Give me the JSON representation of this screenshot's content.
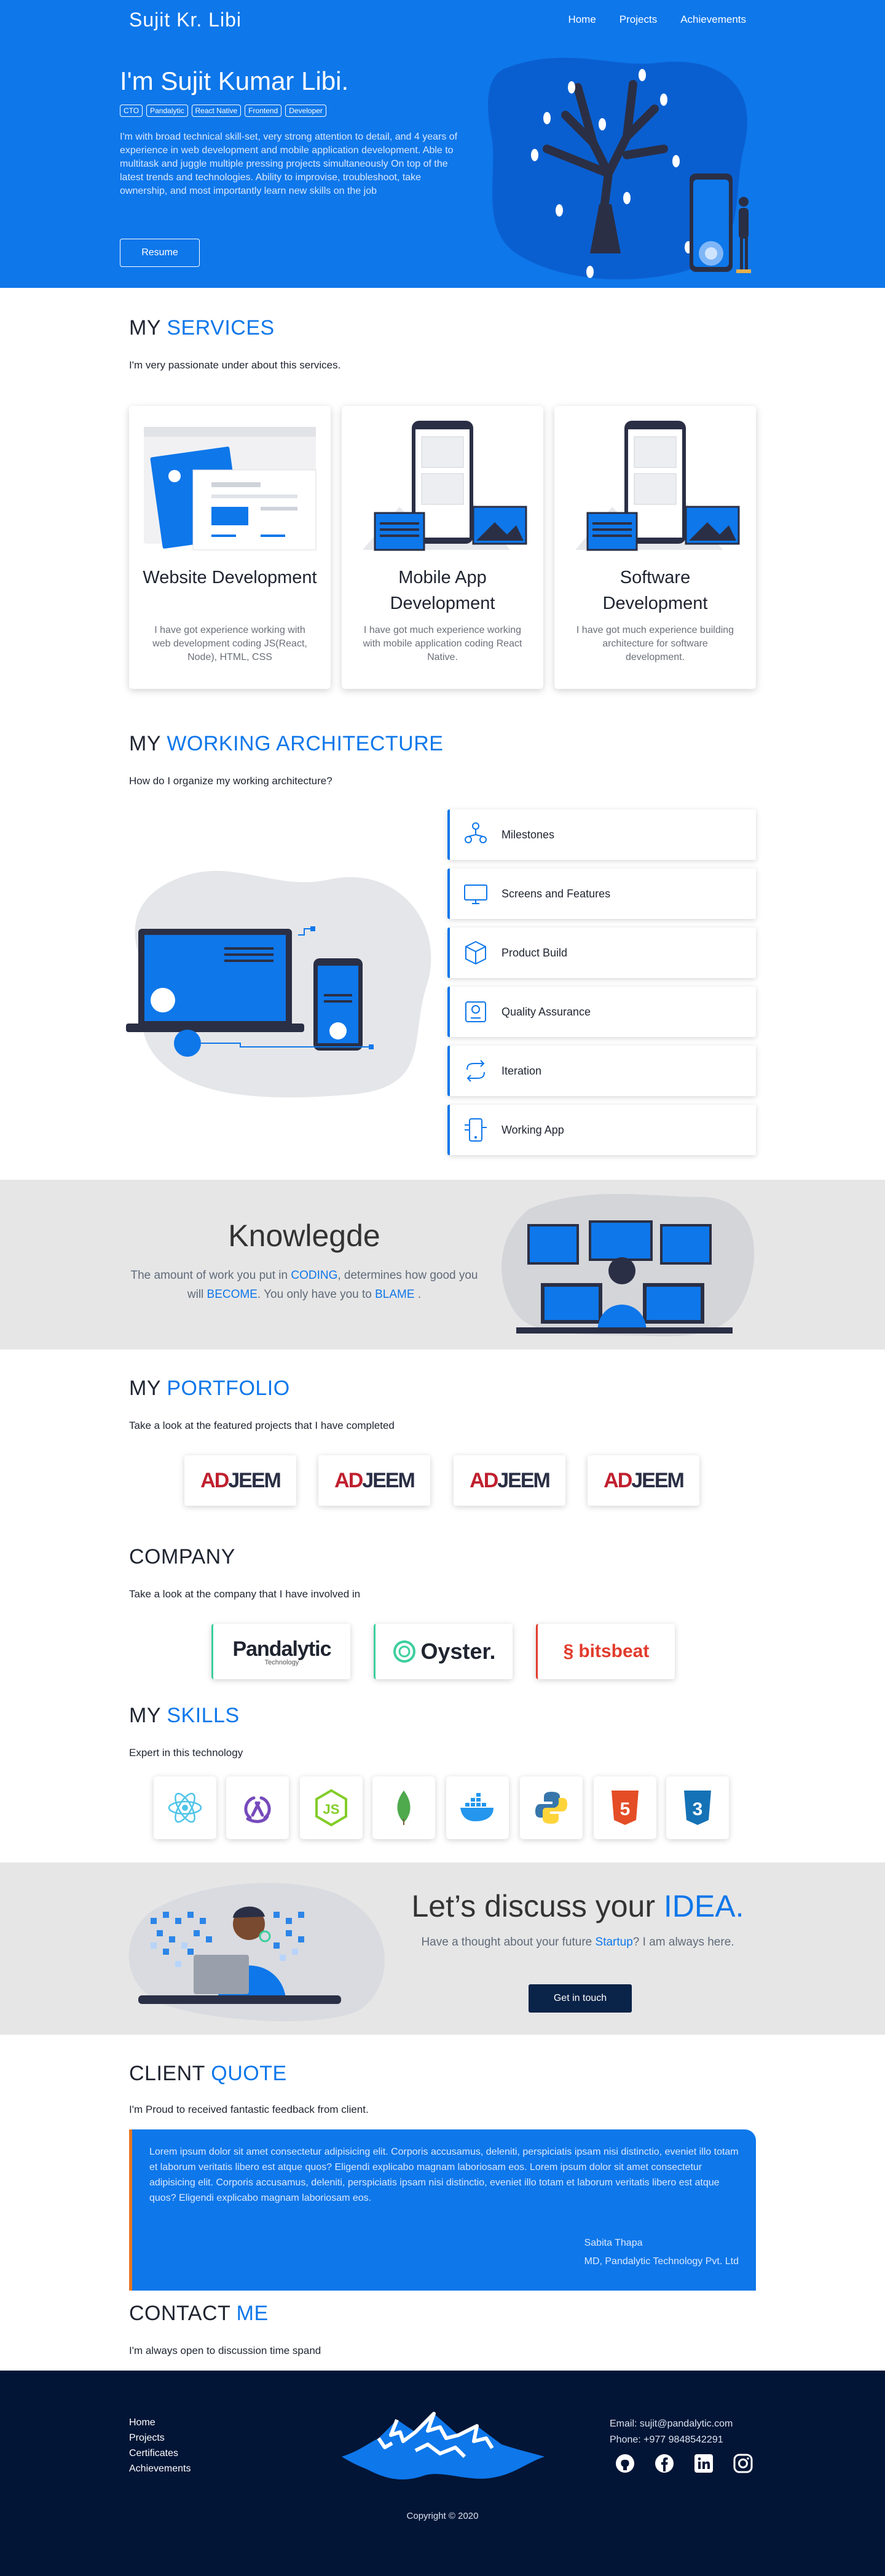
{
  "header": {
    "brand": "Sujit Kr. Libi",
    "nav": [
      "Home",
      "Projects",
      "Achievements"
    ]
  },
  "hero": {
    "title": "I'm Sujit Kumar Libi.",
    "tags": [
      "CTO",
      "Pandalytic",
      "React Native",
      "Frontend",
      "Developer"
    ],
    "description": "I'm with broad technical skill-set, very strong attention to detail, and 4 years of experience in web development and mobile application development. Able to multitask and juggle multiple pressing projects simultaneously On top of the latest trends and technologies. Ability to improvise, troubleshoot, take ownership, and most importantly learn new skills on the job",
    "resume_label": "Resume"
  },
  "services": {
    "title_prefix": "MY",
    "title_highlight": "SERVICES",
    "subtitle": "I'm very passionate under about this services.",
    "cards": [
      {
        "title": "Website Development",
        "text": "I have got experience working with web development coding JS(React, Node), HTML, CSS"
      },
      {
        "title": "Mobile App Development",
        "text": "I have got much experience working with mobile application coding React Native."
      },
      {
        "title": "Software Development",
        "text": "I have got much experience building architecture for software development."
      }
    ]
  },
  "architecture": {
    "title_prefix": "MY",
    "title_highlight": "WORKING ARCHITECTURE",
    "subtitle": "How do I organize my working architecture?",
    "items": [
      {
        "label": "Milestones",
        "icon": "milestones-icon"
      },
      {
        "label": "Screens and Features",
        "icon": "monitor-icon"
      },
      {
        "label": "Product Build",
        "icon": "box-icon"
      },
      {
        "label": "Quality Assurance",
        "icon": "quality-icon"
      },
      {
        "label": "Iteration",
        "icon": "repeat-icon"
      },
      {
        "label": "Working App",
        "icon": "app-icon"
      }
    ]
  },
  "knowledge": {
    "title": "Knowlegde",
    "text_1": "The amount of work you put in ",
    "word_1": "CODING",
    "text_2": ", determines how good you will ",
    "word_2": "BECOME",
    "text_3": ". You only have you to ",
    "word_3": "BLAME",
    "text_4": " ."
  },
  "portfolio": {
    "title_prefix": "MY",
    "title_highlight": "PORTFOLIO",
    "subtitle": "Take a look at the featured projects that I have completed",
    "items": [
      {
        "logo_text_a": "AD",
        "logo_text_b": "JEEM"
      },
      {
        "logo_text_a": "AD",
        "logo_text_b": "JEEM"
      },
      {
        "logo_text_a": "AD",
        "logo_text_b": "JEEM"
      },
      {
        "logo_text_a": "AD",
        "logo_text_b": "JEEM"
      }
    ]
  },
  "company": {
    "title": "COMPANY",
    "subtitle": "Take a look at the company that I have involved in",
    "items": [
      {
        "name": "Pandalytic",
        "tagline": "Technology",
        "color": "#1f7a4a"
      },
      {
        "name": "Oyster.",
        "color": "#3ccf9d"
      },
      {
        "name": "bitsbeat",
        "color": "#e23b2c"
      }
    ]
  },
  "skills": {
    "title_prefix": "MY",
    "title_highlight": "SKILLS",
    "subtitle": "Expert in this technology",
    "items": [
      {
        "icon": "react-icon"
      },
      {
        "icon": "redux-icon"
      },
      {
        "icon": "nodejs-icon"
      },
      {
        "icon": "mongodb-icon"
      },
      {
        "icon": "docker-icon"
      },
      {
        "icon": "python-icon"
      },
      {
        "icon": "html5-icon",
        "label": "5"
      },
      {
        "icon": "css3-icon",
        "label": "3"
      }
    ]
  },
  "idea": {
    "title": "Let’s discuss your ",
    "highlight": "IDEA.",
    "text_1": "Have a thought about your future ",
    "link": "Startup",
    "text_2": "? I am always here.",
    "button": "Get in touch"
  },
  "client": {
    "title_prefix": "CLIENT",
    "title_highlight": "QUOTE",
    "subtitle": "I'm Proud to received fantastic feedback from client.",
    "quote": "Lorem ipsum dolor sit amet consectetur adipisicing elit. Corporis accusamus, deleniti, perspiciatis ipsam nisi distinctio, eveniet illo totam et laborum veritatis libero est atque quos? Eligendi explicabo magnam laboriosam eos. Lorem ipsum dolor sit amet consectetur adipisicing elit. Corporis accusamus, deleniti, perspiciatis ipsam nisi distinctio, eveniet illo totam et laborum veritatis libero est atque quos? Eligendi explicabo magnam laboriosam eos.",
    "author": "Sabita Thapa",
    "role": "MD, Pandalytic Technology Pvt. Ltd"
  },
  "contact": {
    "title_prefix": "CONTACT",
    "title_highlight": "ME",
    "subtitle": "I'm always open to discussion time spand"
  },
  "footer": {
    "links": [
      "Home",
      "Projects",
      "Certificates",
      "Achievements"
    ],
    "email": "Email: sujit@pandalytic.com",
    "phone": "Phone: +977 9848542291",
    "socials": [
      "github-icon",
      "facebook-icon",
      "linkedin-icon",
      "instagram-icon"
    ],
    "copyright": "Copyright © 2020"
  },
  "colors": {
    "primary": "#0e77ea",
    "dark": "#031536",
    "accent": "#e87722"
  }
}
